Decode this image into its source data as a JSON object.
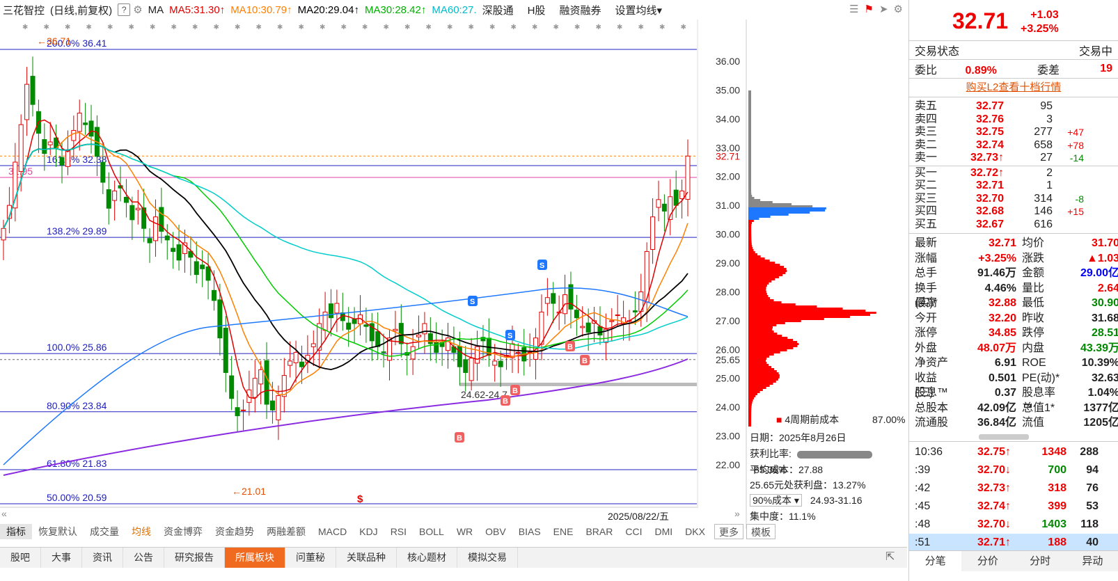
{
  "topbar": {
    "stock_name": "三花智控",
    "period": "(日线,前复权)",
    "help": "?",
    "ma_label": "MA",
    "ma5": "MA5:31.30↑",
    "ma10": "MA10:30.79↑",
    "ma20": "MA20:29.04↑",
    "ma30": "MA30:28.42↑",
    "ma60": "MA60:27.",
    "shgt": "深股通",
    "h": "H股",
    "margin": "融资融券",
    "setma": "设置均线▾",
    "colors": {
      "ma5": "#e00000",
      "ma10": "#ff8000",
      "ma20": "#000000",
      "ma30": "#00cc00",
      "ma60": "#00cccc",
      "ma120": "#1e78ff",
      "ma250": "#8a2be2"
    }
  },
  "chart": {
    "y_ticks": [
      "36.00",
      "35.00",
      "34.00",
      "33.00",
      "32.00",
      "31.00",
      "30.00",
      "29.00",
      "28.00",
      "27.00",
      "26.00",
      "25.00",
      "24.00",
      "23.00",
      "22.00"
    ],
    "current_price_label": "32.71",
    "marker_2565": "25.65",
    "fib_labels": [
      "200.0% 36.41",
      "161.8% 32.38",
      "138.2% 29.89",
      "100.0% 25.86",
      "80.90% 23.84",
      "61.80% 21.83",
      "50.00% 20.59"
    ],
    "high_mark": "←36.71",
    "low_mark": "←21.01",
    "level_3195": "31.95",
    "range_label": "24.62-24.7",
    "date_label": "2025/08/22/五",
    "cost": {
      "legend": "4周期前成本",
      "legend_pct": "87.00%",
      "date": "日期：2025年8月26日",
      "profit_ratio_label": "获利比率:",
      "profit_ratio": "85.36%",
      "avg_cost": "平均成本：27.88",
      "profit_at": "25.65元处获利盘：13.27%",
      "cost_select": "90%成本 ▾",
      "cost_range": "24.93-31.16",
      "concentration": "集中度：11.1%"
    }
  },
  "indicator_tabs": [
    "指标",
    "恢复默认",
    "成交量",
    "均线",
    "资金博弈",
    "资金趋势",
    "两融差额",
    "MACD",
    "KDJ",
    "RSI",
    "BOLL",
    "WR",
    "OBV",
    "BIAS",
    "ENE",
    "BRAR",
    "CCI",
    "DMI",
    "DKX",
    "更多",
    "模板"
  ],
  "bottom_tabs": [
    "股吧",
    "大事",
    "资讯",
    "公告",
    "研究报告",
    "所属板块",
    "问董秘",
    "关联品种",
    "核心题材",
    "模拟交易"
  ],
  "sidebar": {
    "price": "32.71",
    "change": "+1.03",
    "change_pct": "+3.25%",
    "trade_status_label": "交易状态",
    "trade_status": "交易中",
    "weibi_label": "委比",
    "weibi": "0.89%",
    "weicha_label": "委差",
    "weicha": "19",
    "l2_link": "购买L2查看十档行情",
    "asks": [
      {
        "label": "卖五",
        "price": "32.77",
        "vol": "95",
        "delta": ""
      },
      {
        "label": "卖四",
        "price": "32.76",
        "vol": "3",
        "delta": ""
      },
      {
        "label": "卖三",
        "price": "32.75",
        "vol": "277",
        "delta": "+47"
      },
      {
        "label": "卖二",
        "price": "32.74",
        "vol": "658",
        "delta": "+78"
      },
      {
        "label": "卖一",
        "price": "32.73↑",
        "vol": "27",
        "delta": "-14"
      }
    ],
    "bids": [
      {
        "label": "买一",
        "price": "32.72↑",
        "vol": "2",
        "delta": ""
      },
      {
        "label": "买二",
        "price": "32.71",
        "vol": "1",
        "delta": ""
      },
      {
        "label": "买三",
        "price": "32.70",
        "vol": "314",
        "delta": "-8"
      },
      {
        "label": "买四",
        "price": "32.68",
        "vol": "146",
        "delta": "+15"
      },
      {
        "label": "买五",
        "price": "32.67",
        "vol": "616",
        "delta": ""
      }
    ],
    "stats": [
      [
        "最新",
        "32.71",
        "均价",
        "31.70"
      ],
      [
        "涨幅",
        "+3.25%",
        "涨跌",
        "▲1.03"
      ],
      [
        "总手",
        "91.46万",
        "金额",
        "29.00亿"
      ],
      [
        "换手(实)*",
        "4.46%",
        "量比",
        "2.64"
      ],
      [
        "最高",
        "32.88",
        "最低",
        "30.90"
      ],
      [
        "今开",
        "32.20",
        "昨收",
        "31.68"
      ],
      [
        "涨停",
        "34.85",
        "跌停",
        "28.51"
      ],
      [
        "外盘",
        "48.07万",
        "内盘",
        "43.39万"
      ],
      [
        "净资产",
        "6.91",
        "ROE",
        "10.39%"
      ],
      [
        "收益(三)",
        "0.501",
        "PE(动)*",
        "32.63"
      ],
      [
        "股息™",
        "0.37",
        "股息率™",
        "1.04%"
      ],
      [
        "总股本",
        "42.09亿",
        "总值1*",
        "1377亿"
      ],
      [
        "流通股",
        "36.84亿",
        "流值",
        "1205亿"
      ]
    ],
    "ticks": [
      {
        "time": "10:36",
        "price": "32.75↑",
        "vol": "1348",
        "n": "288",
        "dir": "up"
      },
      {
        "time": ":39",
        "price": "32.70↓",
        "vol": "700",
        "n": "94",
        "dir": "down"
      },
      {
        "time": ":42",
        "price": "32.73↑",
        "vol": "318",
        "n": "76",
        "dir": "up"
      },
      {
        "time": ":45",
        "price": "32.74↑",
        "vol": "399",
        "n": "53",
        "dir": "up"
      },
      {
        "time": ":48",
        "price": "32.70↓",
        "vol": "1403",
        "n": "118",
        "dir": "down"
      },
      {
        "time": ":51",
        "price": "32.71↑",
        "vol": "188",
        "n": "40",
        "dir": "up"
      }
    ],
    "tabs": [
      "分笔",
      "分价",
      "分时",
      "异动"
    ]
  }
}
